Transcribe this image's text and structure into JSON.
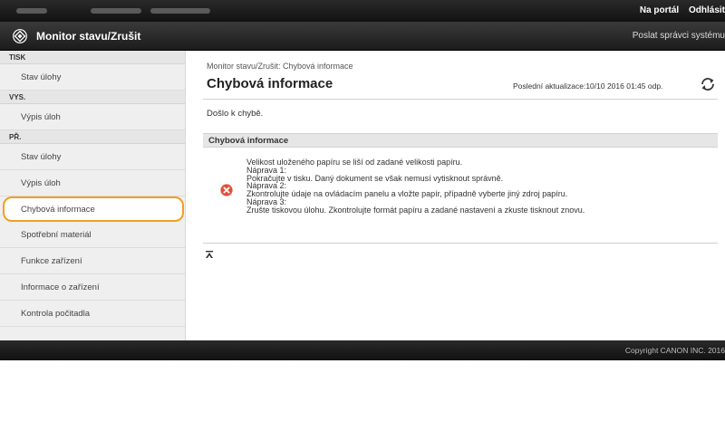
{
  "topbar": {
    "portal_link": "Na portál",
    "logout_link": "Odhlásit"
  },
  "header": {
    "title": "Monitor stavu/Zrušit",
    "admin_link": "Poslat správci systému"
  },
  "sidebar": {
    "sections": [
      {
        "label": "TISK",
        "items": [
          "Stav úlohy"
        ]
      },
      {
        "label": "VYS.",
        "items": [
          "Výpis úloh"
        ]
      },
      {
        "label": "PŘ.",
        "items": [
          "Stav úlohy",
          "Výpis úloh"
        ]
      }
    ],
    "items": [
      "Chybová informace",
      "Spotřební materiál",
      "Funkce zařízení",
      "Informace o zařízení",
      "Kontrola počitadla"
    ]
  },
  "main": {
    "breadcrumb": "Monitor stavu/Zrušit: Chybová informace",
    "title": "Chybová informace",
    "last_update": "Poslední aktualizace:10/10 2016 01:45 odp.",
    "message": "Došlo k chybě.",
    "section_title": "Chybová informace",
    "details": [
      "Velikost uloženého papíru se liší od zadané velikosti papíru.",
      "Nápravа 1:",
      "Pokračujte v tisku. Daný dokument se však nemusí vytisknout správně.",
      "Náprava 2:",
      "Zkontrolujte údaje na ovládacím panelu a vložte papír, případně vyberte jiný zdroj papíru.",
      "Náprava 3:",
      "Zrušte tiskovou úlohu. Zkontrolujte formát papíru a zadané nastavení a zkuste tisknout znovu."
    ]
  },
  "footer": {
    "copyright": "Copyright CANON INC. 2016"
  },
  "colors": {
    "highlight": "#f0a020",
    "error": "#e0523a",
    "dark_bar": "#1c1c1c"
  }
}
